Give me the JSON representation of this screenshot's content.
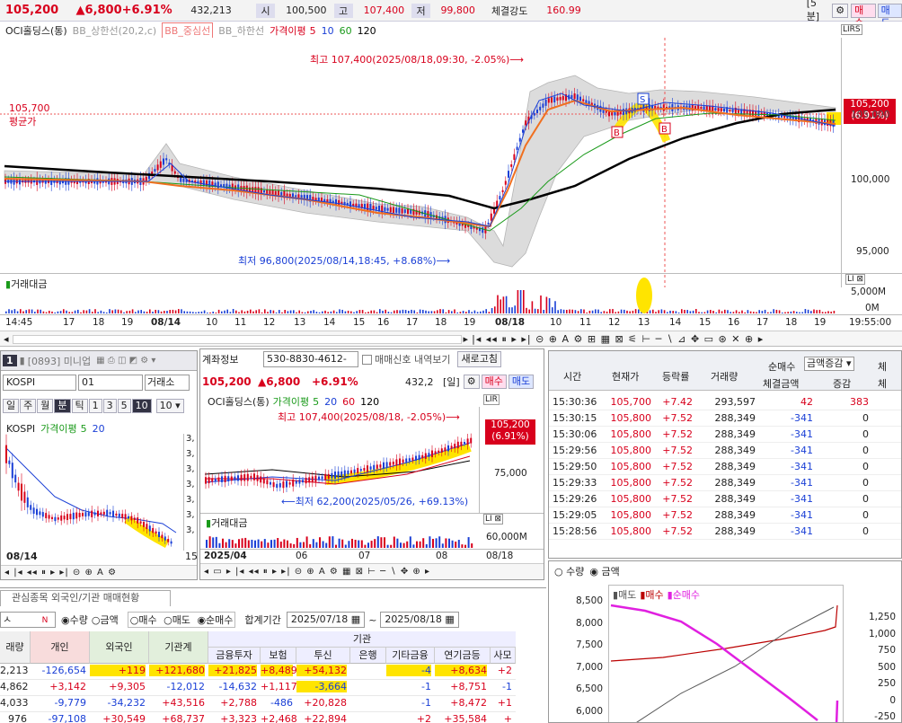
{
  "top": {
    "price": "105,200",
    "change": "▲6,800",
    "pct": "+6.91%",
    "volume": "432,213",
    "open_lbl": "시",
    "open": "100,500",
    "high_lbl": "고",
    "high": "107,400",
    "low_lbl": "저",
    "low": "99,800",
    "strength_lbl": "체결강도",
    "strength": "160.99",
    "interval": "[5분]",
    "buy": "매수",
    "sell": "매도"
  },
  "legend": {
    "name": "OCI홀딩스(통)",
    "bb_up": "BB_상한선(20,2,c)",
    "bb_mid": "BB_중심선",
    "bb_low": "BB_하한선",
    "dev": "가격이평",
    "d5": "5",
    "d10": "10",
    "d60": "60",
    "d120": "120"
  },
  "main_chart": {
    "high_note": "최고 107,400(2025/08/18,09:30, -2.05%)⟶",
    "low_note": "최저 96,800(2025/08/14,18:45, +8.68%)⟶",
    "avg_price": "105,700",
    "avg_label": "평균가",
    "price_tag": "105,200",
    "price_tag_pct": "(6.91%)",
    "y_ticks": [
      "105,000",
      "100,000",
      "95,000"
    ],
    "vol_label": "거래대금",
    "vol_ticks": [
      "5,000M",
      "0M"
    ],
    "x_ticks": [
      "14:45",
      "17",
      "18",
      "19",
      "08/14",
      "10",
      "11",
      "12",
      "13",
      "14",
      "15",
      "16",
      "17",
      "18",
      "19",
      "08/18",
      "10",
      "11",
      "12",
      "13",
      "14",
      "15",
      "16",
      "17",
      "18",
      "19",
      "19:55:00"
    ],
    "marker_s": "S",
    "marker_b": "B"
  },
  "mini": {
    "window_num": "1",
    "title": "[0893] 미니업",
    "market": "KOSPI",
    "code": "01",
    "exch": "거래소",
    "periods": [
      "일",
      "주",
      "월",
      "분",
      "틱",
      "1",
      "3",
      "5",
      "10"
    ],
    "period_sel": "10",
    "legend_name": "KOSPI",
    "legend_ma": "가격이평",
    "legend_5": "5",
    "legend_20": "20",
    "y_ticks": [
      "3,",
      "3,",
      "3,",
      "3,",
      "3,",
      "3,",
      "3,"
    ],
    "date": "08/14",
    "tail": "15"
  },
  "daily": {
    "acct_lbl": "계좌정보",
    "acct_no": "530-8830-4612-",
    "signal_lbl": "매매신호 내역보기",
    "refresh": "새로고침",
    "price": "105,200",
    "change": "▲6,800",
    "pct": "+6.91%",
    "volume": "432,2",
    "unit": "[일]",
    "buy": "매수",
    "sell": "매도",
    "legend_name": "OCI홀딩스(통)",
    "legend_ma": "가격이평",
    "l5": "5",
    "l20": "20",
    "l60": "60",
    "l120": "120",
    "high_note": "최고 107,400(2025/08/18, -2.05%)⟶",
    "low_note": "⟵최저 62,200(2025/05/26, +69.13%)",
    "tag": "105,200",
    "tag_pct": "(6.91%)",
    "y_tick": "75,000",
    "vol_label": "거래대금",
    "vol_tick": "60,000M",
    "x_ticks": [
      "2025/04",
      "06",
      "07",
      "08",
      "08/18"
    ]
  },
  "trades": {
    "headers": [
      "시간",
      "현재가",
      "등락률",
      "거래량",
      "순매수",
      "체결금액",
      "증감",
      "체"
    ],
    "sel": "금액증감",
    "rows": [
      [
        "15:30:36",
        "105,700",
        "+7.42",
        "293,597",
        "42",
        "383"
      ],
      [
        "15:30:15",
        "105,800",
        "+7.52",
        "288,349",
        "-341",
        "0"
      ],
      [
        "15:30:06",
        "105,800",
        "+7.52",
        "288,349",
        "-341",
        "0"
      ],
      [
        "15:29:56",
        "105,800",
        "+7.52",
        "288,349",
        "-341",
        "0"
      ],
      [
        "15:29:50",
        "105,800",
        "+7.52",
        "288,349",
        "-341",
        "0"
      ],
      [
        "15:29:33",
        "105,800",
        "+7.52",
        "288,349",
        "-341",
        "0"
      ],
      [
        "15:29:26",
        "105,800",
        "+7.52",
        "288,349",
        "-341",
        "0"
      ],
      [
        "15:29:05",
        "105,800",
        "+7.52",
        "288,349",
        "-341",
        "0"
      ],
      [
        "15:28:56",
        "105,800",
        "+7.52",
        "288,349",
        "-341",
        "0"
      ]
    ]
  },
  "investor": {
    "tab1": "관심종목 외국인/기관 매매현황",
    "radio1": [
      "수량",
      "금액"
    ],
    "radio2": [
      "매수",
      "매도",
      "순매수"
    ],
    "period_lbl": "합계기간",
    "from": "2025/07/18",
    "to": "2025/08/18",
    "cols_top": [
      "래량",
      "개인",
      "외국인",
      "기관계"
    ],
    "inst_lbl": "기관",
    "cols_sub": [
      "금융투자",
      "보험",
      "투신",
      "은행",
      "기타금융",
      "연기금등",
      "사모"
    ],
    "rows": [
      [
        "2,213",
        "-126,654",
        "+119",
        "+121,680",
        "+21,825",
        "+8,489",
        "+54,132",
        "",
        "-4",
        "+8,634",
        "+2"
      ],
      [
        "4,862",
        "+3,142",
        "+9,305",
        "-12,012",
        "-14,632",
        "+1,117",
        "-3,664",
        "",
        "-1",
        "+8,751",
        "-1"
      ],
      [
        "4,033",
        "-9,779",
        "-34,232",
        "+43,516",
        "+2,788",
        "-486",
        "+20,828",
        "",
        "-1",
        "+8,472",
        "+1"
      ],
      [
        "976",
        "-97,108",
        "+30,549",
        "+68,737",
        "+3,323",
        "+2,468",
        "+22,894",
        "",
        "+2",
        "+35,584",
        "+"
      ]
    ]
  },
  "flow": {
    "radio": [
      "수량",
      "금액"
    ],
    "legend": [
      "매도",
      "매수",
      "순매수"
    ],
    "left_ticks": [
      "8,500",
      "8,000",
      "7,500",
      "7,000",
      "6,500",
      "6,000"
    ],
    "right_ticks": [
      "1,250",
      "1,000",
      "750",
      "500",
      "250",
      "0",
      "-250"
    ]
  }
}
